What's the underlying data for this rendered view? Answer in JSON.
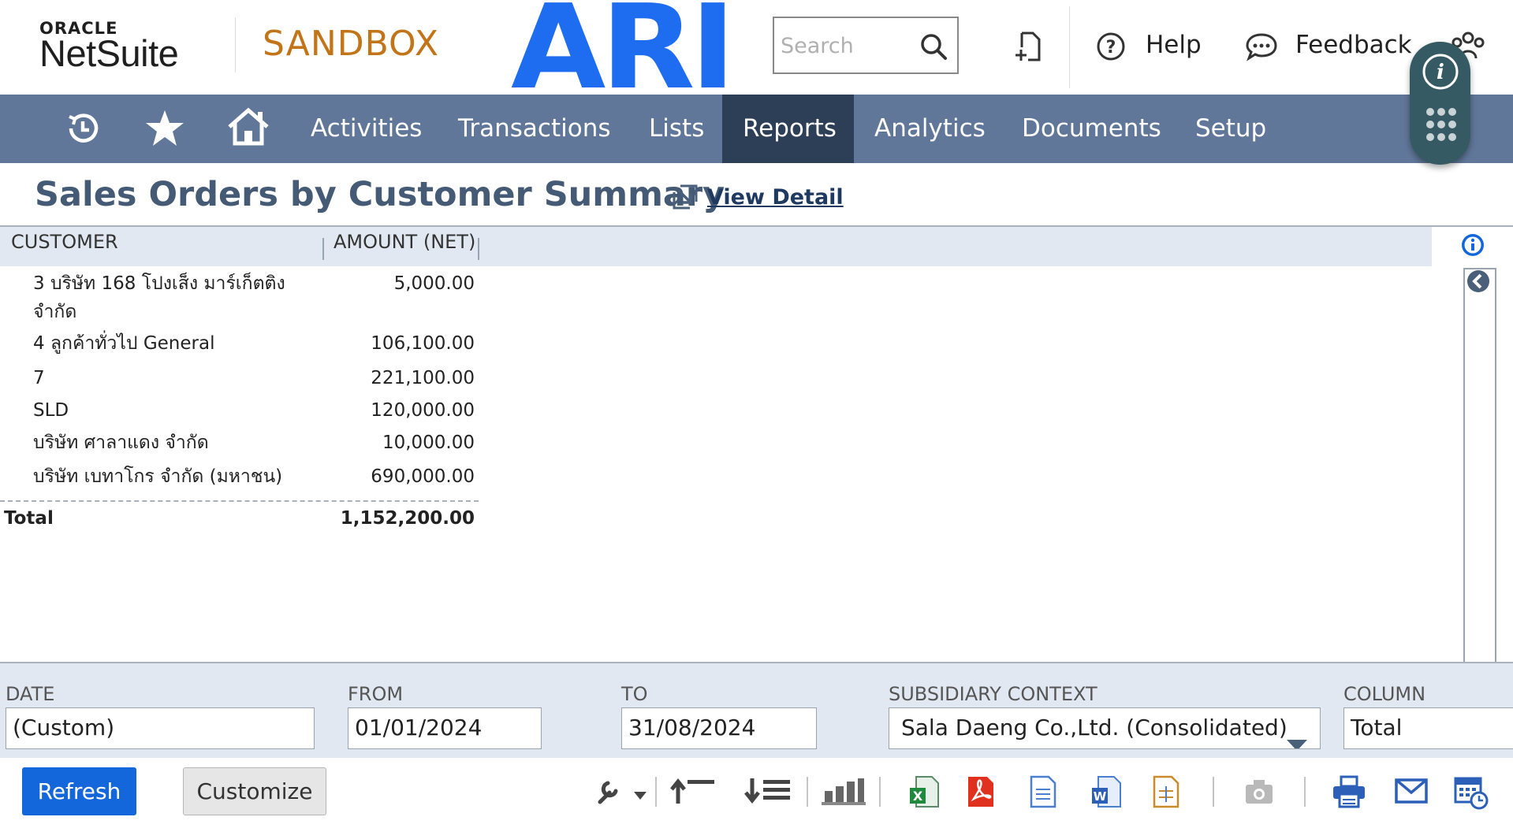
{
  "header": {
    "logo_top": "ORACLE",
    "logo_bottom": "NetSuite",
    "environment": "SANDBOX",
    "brand_text": "ARI",
    "search_placeholder": "Search",
    "help_label": "Help",
    "feedback_label": "Feedback"
  },
  "nav": {
    "items": [
      "Activities",
      "Transactions",
      "Lists",
      "Reports",
      "Analytics",
      "Documents",
      "Setup"
    ],
    "active": "Reports"
  },
  "report": {
    "title": "Sales Orders by Customer Summary",
    "view_detail_label": "View Detail",
    "columns": [
      "CUSTOMER",
      "AMOUNT (NET)"
    ],
    "rows": [
      {
        "customer": "3 บริษัท 168 โปงเส็ง มาร์เก็ตติง จำกัด",
        "amount": "5,000.00"
      },
      {
        "customer": "4 ลูกค้าทั่วไป General",
        "amount": "106,100.00"
      },
      {
        "customer": "7",
        "amount": "221,100.00"
      },
      {
        "customer": "SLD",
        "amount": "120,000.00"
      },
      {
        "customer": "บริษัท ศาลาแดง จำกัด",
        "amount": "10,000.00"
      },
      {
        "customer": "บริษัท เบทาโกร จำกัด (มหาชน)",
        "amount": "690,000.00"
      }
    ],
    "total_label": "Total",
    "total_amount": "1,152,200.00"
  },
  "filters": {
    "date_label": "DATE",
    "date_value": "(Custom)",
    "from_label": "FROM",
    "from_value": "01/01/2024",
    "to_label": "TO",
    "to_value": "31/08/2024",
    "subsidiary_label": "SUBSIDIARY CONTEXT",
    "subsidiary_value": "Sala Daeng Co.,Ltd. (Consolidated)",
    "column_label": "COLUMN",
    "column_value": "Total"
  },
  "buttons": {
    "refresh": "Refresh",
    "customize": "Customize"
  },
  "colors": {
    "nav_bg": "#607799",
    "nav_active": "#2d3f57",
    "sandbox": "#c27418",
    "brand": "#1e6cf0",
    "primary_button": "#1467db",
    "title": "#455a74"
  }
}
